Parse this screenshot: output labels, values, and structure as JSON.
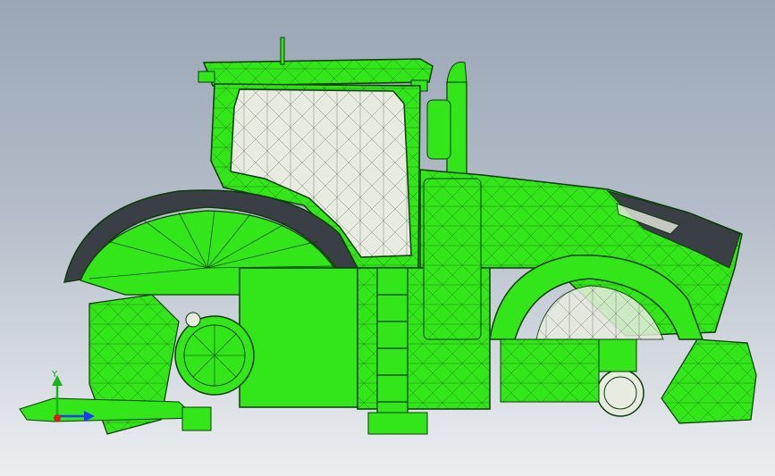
{
  "viewport": {
    "background_top": "#9aa6b6",
    "background_bottom": "#eceef1"
  },
  "model": {
    "icon": "tractor-wireframe-model",
    "body_color": "#33e61a",
    "edge_color": "#0b3a06",
    "glass_color": "#e8ece0",
    "dark_panel_color": "#3a3f45"
  },
  "triad": {
    "y_label": "Y",
    "x_color": "#1a3aff",
    "y_color": "#1ab41a",
    "z_color": "#e01a1a"
  }
}
